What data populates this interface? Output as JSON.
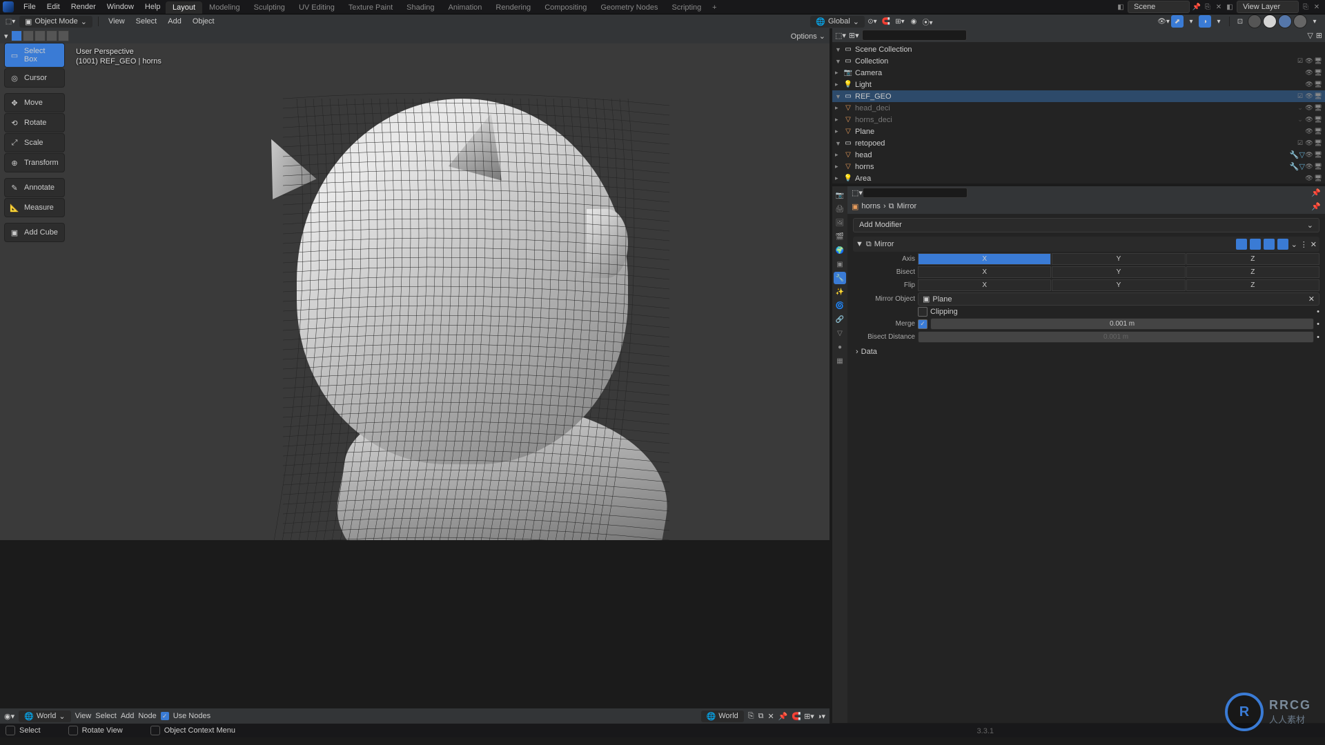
{
  "menu": {
    "file": "File",
    "edit": "Edit",
    "render": "Render",
    "window": "Window",
    "help": "Help"
  },
  "workspaces": [
    "Layout",
    "Modeling",
    "Sculpting",
    "UV Editing",
    "Texture Paint",
    "Shading",
    "Animation",
    "Rendering",
    "Compositing",
    "Geometry Nodes",
    "Scripting"
  ],
  "workspace_active": 0,
  "scene": "Scene",
  "view_layer": "View Layer",
  "header": {
    "mode": "Object Mode",
    "menus": [
      "View",
      "Select",
      "Add",
      "Object"
    ],
    "orient": "Global",
    "options": "Options"
  },
  "viewport": {
    "persp": "User Perspective",
    "obj": "(1001) REF_GEO | horns"
  },
  "tools": [
    {
      "name": "Select Box",
      "active": true,
      "icon": "▭"
    },
    {
      "name": "Cursor",
      "icon": "◎"
    },
    {
      "name": "Move",
      "icon": "✥"
    },
    {
      "name": "Rotate",
      "icon": "⟲"
    },
    {
      "name": "Scale",
      "icon": "⤢"
    },
    {
      "name": "Transform",
      "icon": "⊕"
    },
    {
      "name": "Annotate",
      "icon": "✎"
    },
    {
      "name": "Measure",
      "icon": "📐"
    },
    {
      "name": "Add Cube",
      "icon": "▣"
    }
  ],
  "outliner": {
    "scene_collection": "Scene Collection",
    "items": [
      {
        "name": "Collection",
        "type": "col",
        "depth": 1,
        "exp": "▼",
        "chk": true
      },
      {
        "name": "Camera",
        "type": "cam",
        "depth": 2,
        "exp": "▸"
      },
      {
        "name": "Light",
        "type": "light",
        "depth": 2,
        "exp": "▸"
      },
      {
        "name": "REF_GEO",
        "type": "col",
        "depth": 1,
        "exp": "▼",
        "chk": true,
        "sel": true
      },
      {
        "name": "head_deci",
        "type": "mesh",
        "depth": 2,
        "exp": "▸",
        "dim": true
      },
      {
        "name": "horns_deci",
        "type": "mesh",
        "depth": 2,
        "exp": "▸",
        "dim": true
      },
      {
        "name": "Plane",
        "type": "mesh",
        "depth": 2,
        "exp": "▸"
      },
      {
        "name": "retopoed",
        "type": "col",
        "depth": 1,
        "exp": "▼",
        "chk": true
      },
      {
        "name": "head",
        "type": "mesh",
        "depth": 2,
        "exp": "▸",
        "mods": true
      },
      {
        "name": "horns",
        "type": "mesh",
        "depth": 2,
        "exp": "▸",
        "mods": true
      },
      {
        "name": "Area",
        "type": "light",
        "depth": 1,
        "exp": "▸"
      }
    ]
  },
  "properties": {
    "breadcrumb": [
      "horns",
      "Mirror"
    ],
    "add_modifier": "Add Modifier",
    "modifier_name": "Mirror",
    "axis_label": "Axis",
    "bisect_label": "Bisect",
    "flip_label": "Flip",
    "x": "X",
    "y": "Y",
    "z": "Z",
    "mirror_object_label": "Mirror Object",
    "mirror_object": "Plane",
    "clipping": "Clipping",
    "merge_label": "Merge",
    "merge_val": "0.001 m",
    "bisect_dist_label": "Bisect Distance",
    "bisect_dist": "0.001 m",
    "data_section": "Data"
  },
  "shader": {
    "world": "World",
    "menus": [
      "View",
      "Select",
      "Add",
      "Node"
    ],
    "use_nodes": "Use Nodes",
    "material": "World"
  },
  "status": {
    "select": "Select",
    "rotate": "Rotate View",
    "context": "Object Context Menu"
  },
  "version": "3.3.1",
  "watermark": "RRCG",
  "watermark_sub": "人人素材"
}
